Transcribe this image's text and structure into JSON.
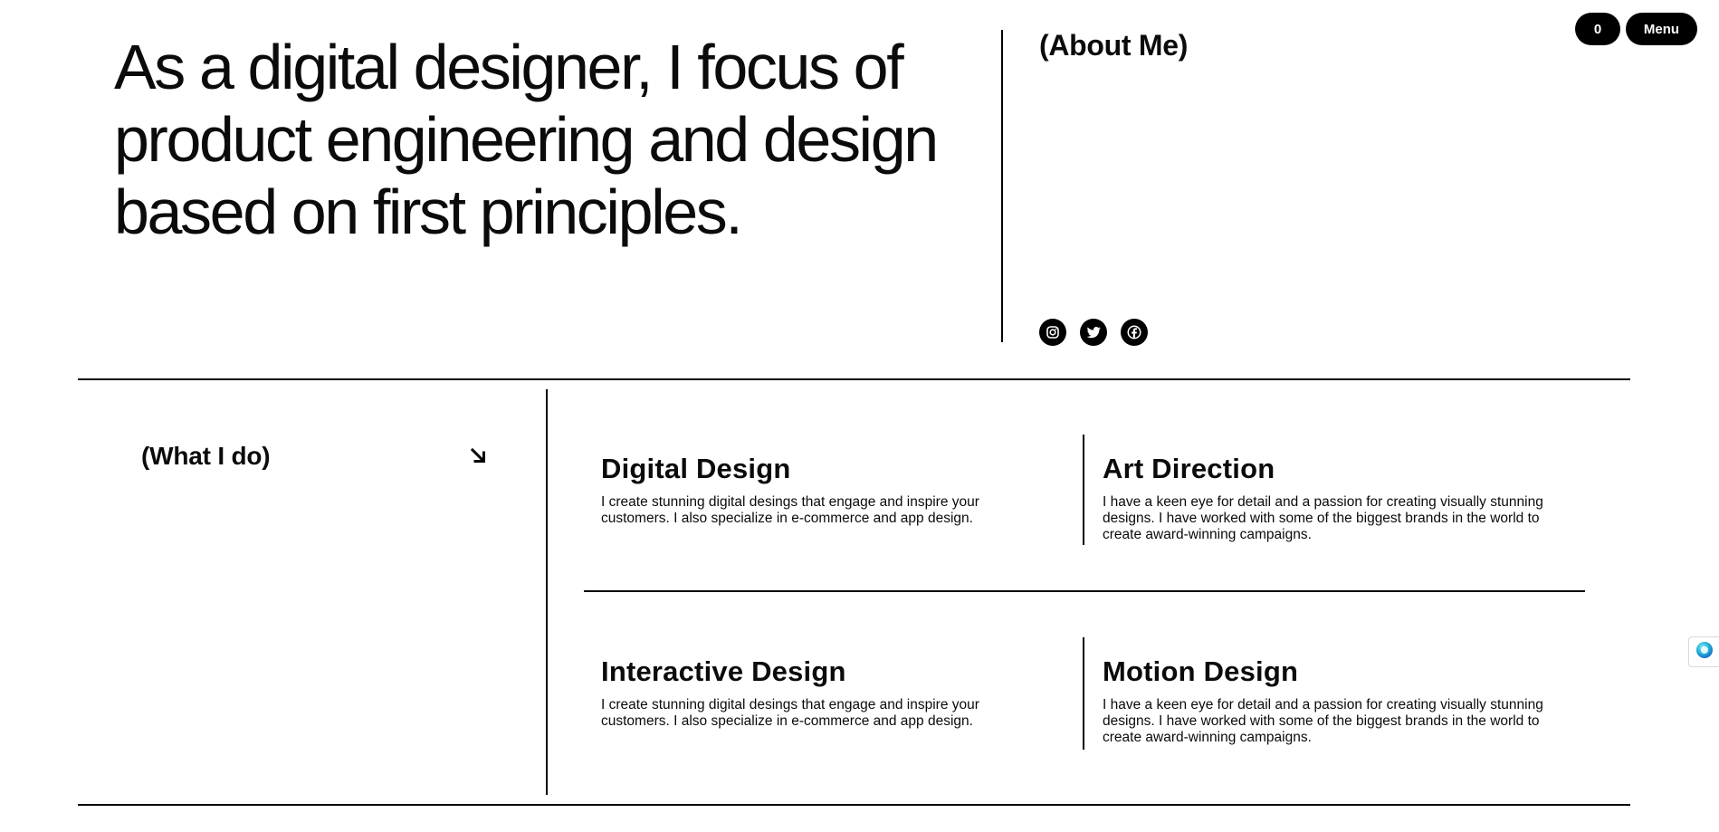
{
  "header": {
    "count_label": "0",
    "menu_label": "Menu"
  },
  "hero": {
    "headline": "As a digital designer, I focus of product engineering and design based on first principles."
  },
  "about": {
    "heading": "(About Me)",
    "socials": [
      {
        "icon": "instagram-icon"
      },
      {
        "icon": "twitter-icon"
      },
      {
        "icon": "facebook-icon"
      }
    ]
  },
  "services_section": {
    "heading": "(What I do)",
    "arrow_icon": "arrow-down-right-icon",
    "items": [
      {
        "title": "Digital Design",
        "description": "I create stunning digital desings that engage and inspire your customers. I also specialize in e-commerce and app design."
      },
      {
        "title": "Art Direction",
        "description": "I have a keen eye for detail and a passion for creating visually stunning designs. I have worked with some of the biggest brands in the world to create award-winning campaigns."
      },
      {
        "title": "Interactive Design",
        "description": "I create stunning digital desings that engage and inspire your customers. I also specialize in e-commerce and app design."
      },
      {
        "title": "Motion Design",
        "description": "I have a keen eye for detail and a passion for creating visually stunning designs. I have worked with some of the biggest brands in the world to create award-winning campaigns."
      }
    ]
  },
  "colors": {
    "text": "#0b0b0b",
    "background": "#ffffff",
    "pill": "#000000",
    "assistant_accent": "#1fb6d6"
  }
}
